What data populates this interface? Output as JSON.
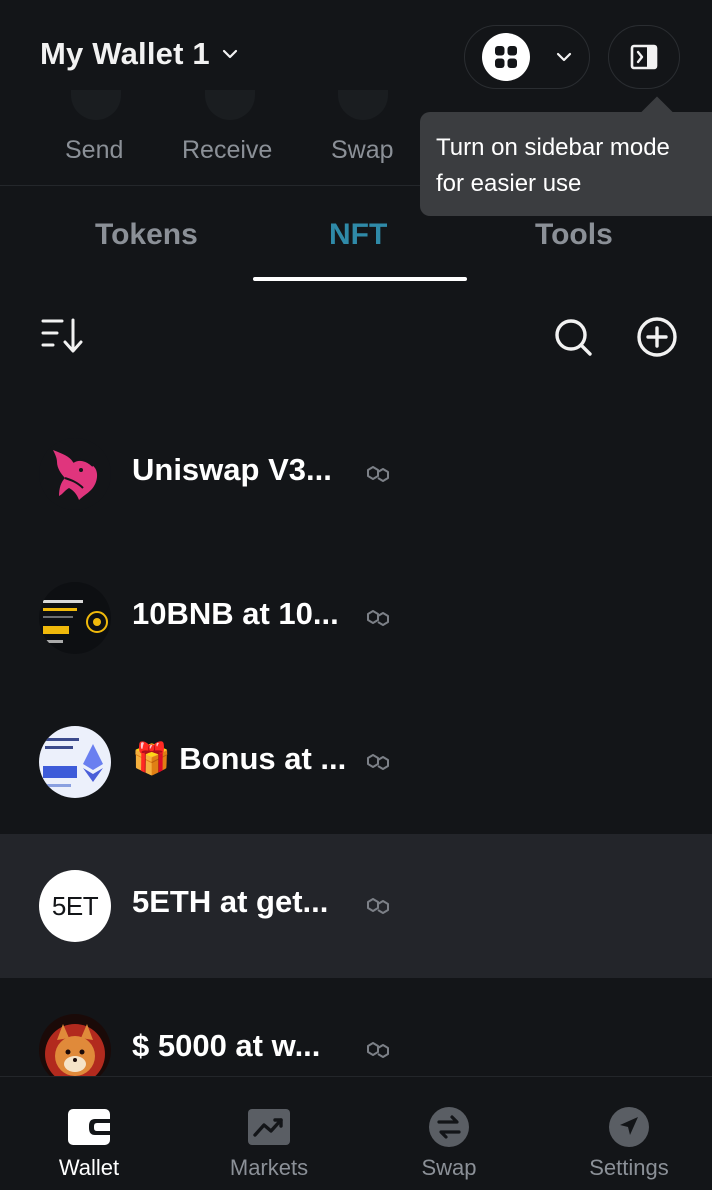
{
  "header": {
    "wallet_name": "My Wallet 1"
  },
  "actions": [
    {
      "label": "Send"
    },
    {
      "label": "Receive"
    },
    {
      "label": "Swap"
    }
  ],
  "tooltip": {
    "line1": "Turn on sidebar mode",
    "line2": "for easier use"
  },
  "tabs": [
    {
      "label": "Tokens",
      "active": false
    },
    {
      "label": "NFT",
      "active": true
    },
    {
      "label": "Tools",
      "active": false
    }
  ],
  "nft_items": [
    {
      "name": "Uniswap V3...",
      "avatar": "uniswap-logo"
    },
    {
      "name": "10BNB at 10...",
      "avatar": "airdrop-image"
    },
    {
      "name": "🎁 Bonus at ...",
      "avatar": "eth-airdrop-image"
    },
    {
      "name": "5ETH at get...",
      "avatar_text": "5ET",
      "highlighted": true
    },
    {
      "name": "$ 5000 at w...",
      "avatar": "shiba-image"
    }
  ],
  "bottom_nav": [
    {
      "label": "Wallet",
      "icon": "wallet-icon",
      "active": true
    },
    {
      "label": "Markets",
      "icon": "chart-icon",
      "active": false
    },
    {
      "label": "Swap",
      "icon": "swap-icon",
      "active": false
    },
    {
      "label": "Settings",
      "icon": "navigation-arrow-icon",
      "active": false
    }
  ],
  "colors": {
    "background": "#131518",
    "accent_tab": "#2f8aa8",
    "muted_text": "#8b9097",
    "tooltip_bg": "#3b3d40",
    "uniswap_pink": "#e0357d"
  }
}
